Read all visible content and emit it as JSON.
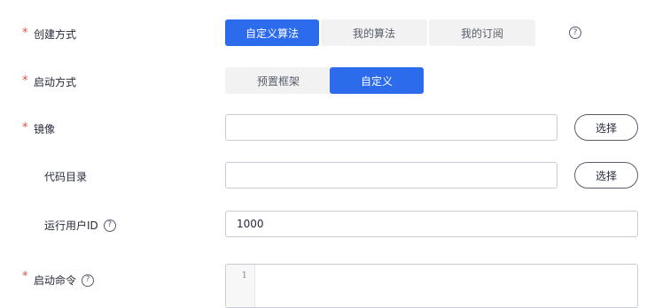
{
  "form": {
    "create_mode": {
      "label": "创建方式",
      "options": [
        "自定义算法",
        "我的算法",
        "我的订阅"
      ],
      "selected": "自定义算法",
      "help_icon": "question-circle-icon"
    },
    "boot_mode": {
      "label": "启动方式",
      "options": [
        "预置框架",
        "自定义"
      ],
      "selected": "自定义"
    },
    "image": {
      "label": "镜像",
      "value": "",
      "select_label": "选择"
    },
    "code_dir": {
      "label": "代码目录",
      "value": "",
      "select_label": "选择"
    },
    "run_user_id": {
      "label": "运行用户ID",
      "value": "1000",
      "help_icon": "question-circle-icon"
    },
    "boot_command": {
      "label": "启动命令",
      "line_number": "1",
      "help_icon": "question-circle-icon"
    },
    "required_mark": "*",
    "help_glyph": "?"
  },
  "colors": {
    "accent": "#2d6bed",
    "required": "#e84c3d",
    "segment_bg": "#f2f2f2",
    "border": "#c7cbd4"
  }
}
